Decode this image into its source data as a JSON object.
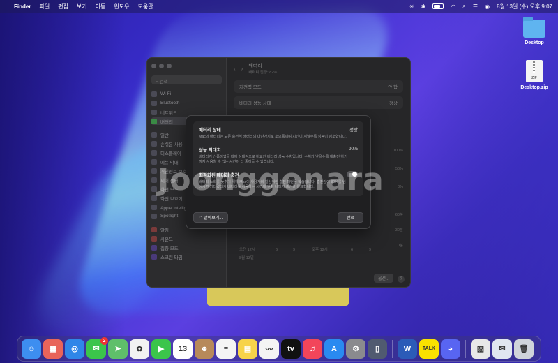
{
  "menubar": {
    "app": "Finder",
    "items": [
      "파일",
      "편집",
      "보기",
      "이동",
      "윈도우",
      "도움말"
    ],
    "datetime": "8월 13일 (수) 오후 9:07"
  },
  "desktop": {
    "icons": [
      {
        "label": "Desktop",
        "kind": "folder"
      },
      {
        "label": "Desktop.zip",
        "kind": "zip",
        "badge": "ZIP"
      }
    ]
  },
  "window": {
    "search_placeholder": "검색",
    "sidebar_items": [
      "Wi-Fi",
      "Bluetooth",
      "네트워크",
      "배터리",
      "일반",
      "손쉬운 사용",
      "디스플레이",
      "메뉴 막대",
      "개인정보 보호 및 보안",
      "제어 센터",
      "화면 모드",
      "화면 보호기",
      "Apple Intelligence 및 Siri",
      "Spotlight",
      "알림",
      "사운드",
      "집중 모드",
      "스크린 타임"
    ],
    "header_title": "배터리",
    "header_sub": "배터리 잔량: 82%",
    "rows": [
      {
        "label": "저전력 모드",
        "value": "안 함"
      },
      {
        "label": "배터리 성능 상태",
        "value": "정상"
      }
    ],
    "axis_right": [
      "100%",
      "50%",
      "0%",
      "60분",
      "30분",
      "0분"
    ],
    "axis_bottom": [
      "오전 12시",
      "6",
      "9",
      "오후 12시",
      "6",
      "9"
    ],
    "date_label": "8월 13일",
    "options_label": "옵션...",
    "help_label": "?"
  },
  "sheet": {
    "sections": [
      {
        "title": "배터리 상태",
        "value": "정상",
        "desc": "Mac의 배터리는 모든 충전식 배터리의 마찬가지로 소모품이며 시간이 지날수록 성능이 감소합니다."
      },
      {
        "title": "성능 최대치",
        "value": "90%",
        "desc": "배터리가 신품이었을 때에 상대적으로 비교한 배터리 성능 수치입니다. 수치가 낮을수록 재충전 하기까지 사용할 수 있는 시간이 더 줄어들 수 있습니다."
      },
      {
        "title": "최적화된 배터리 충전",
        "value": "",
        "desc": "배터리 노화를 늦추기 위해 Mac이 사용자의 일상적인 충전 패턴을 학습합니다. 충전량이 80%를 넘어가면 기다렸다가 배터리를 사용하는 시간에 맞춰 나머지 충전을 완료합니다."
      }
    ],
    "learn_more": "더 알아보기...",
    "done": "완료"
  },
  "watermark": "Joonggonara",
  "dock": {
    "apps": [
      {
        "name": "finder",
        "color": "#3d8ef0",
        "glyph": "☺"
      },
      {
        "name": "launchpad",
        "color": "#e8645a",
        "glyph": "▦"
      },
      {
        "name": "safari",
        "color": "#2f86e8",
        "glyph": "◎"
      },
      {
        "name": "messages",
        "color": "#3bc54b",
        "glyph": "✉",
        "badge": "2"
      },
      {
        "name": "maps",
        "color": "#5fbf6a",
        "glyph": "➤"
      },
      {
        "name": "photos",
        "color": "#f2f2f2",
        "glyph": "✿"
      },
      {
        "name": "facetime",
        "color": "#3bc54b",
        "glyph": "▶"
      },
      {
        "name": "calendar",
        "color": "#ffffff",
        "glyph": "13"
      },
      {
        "name": "contacts",
        "color": "#b7895a",
        "glyph": "☻"
      },
      {
        "name": "reminders",
        "color": "#f4f4f4",
        "glyph": "≡"
      },
      {
        "name": "notes",
        "color": "#f7d34a",
        "glyph": "▤"
      },
      {
        "name": "freeform",
        "color": "#f4f4f4",
        "glyph": "〰"
      },
      {
        "name": "apple-tv",
        "color": "#111111",
        "glyph": "tv"
      },
      {
        "name": "music",
        "color": "#f2455a",
        "glyph": "♫"
      },
      {
        "name": "app-store",
        "color": "#2a8af0",
        "glyph": "A"
      },
      {
        "name": "system-settings",
        "color": "#8a8a8e",
        "glyph": "⚙"
      },
      {
        "name": "iphone-mirroring",
        "color": "#505a70",
        "glyph": "▯"
      },
      {
        "name": "word",
        "color": "#2b5bb8",
        "glyph": "W"
      },
      {
        "name": "kakaotalk",
        "color": "#fae100",
        "glyph": "TALK"
      },
      {
        "name": "discord",
        "color": "#5865f2",
        "glyph": "◕"
      },
      {
        "name": "preview",
        "color": "#e8e8e8",
        "glyph": "▧"
      },
      {
        "name": "mail-file",
        "color": "#e0e6f0",
        "glyph": "✉"
      },
      {
        "name": "trash",
        "color": "#cfd3da",
        "glyph": "🗑"
      }
    ]
  }
}
